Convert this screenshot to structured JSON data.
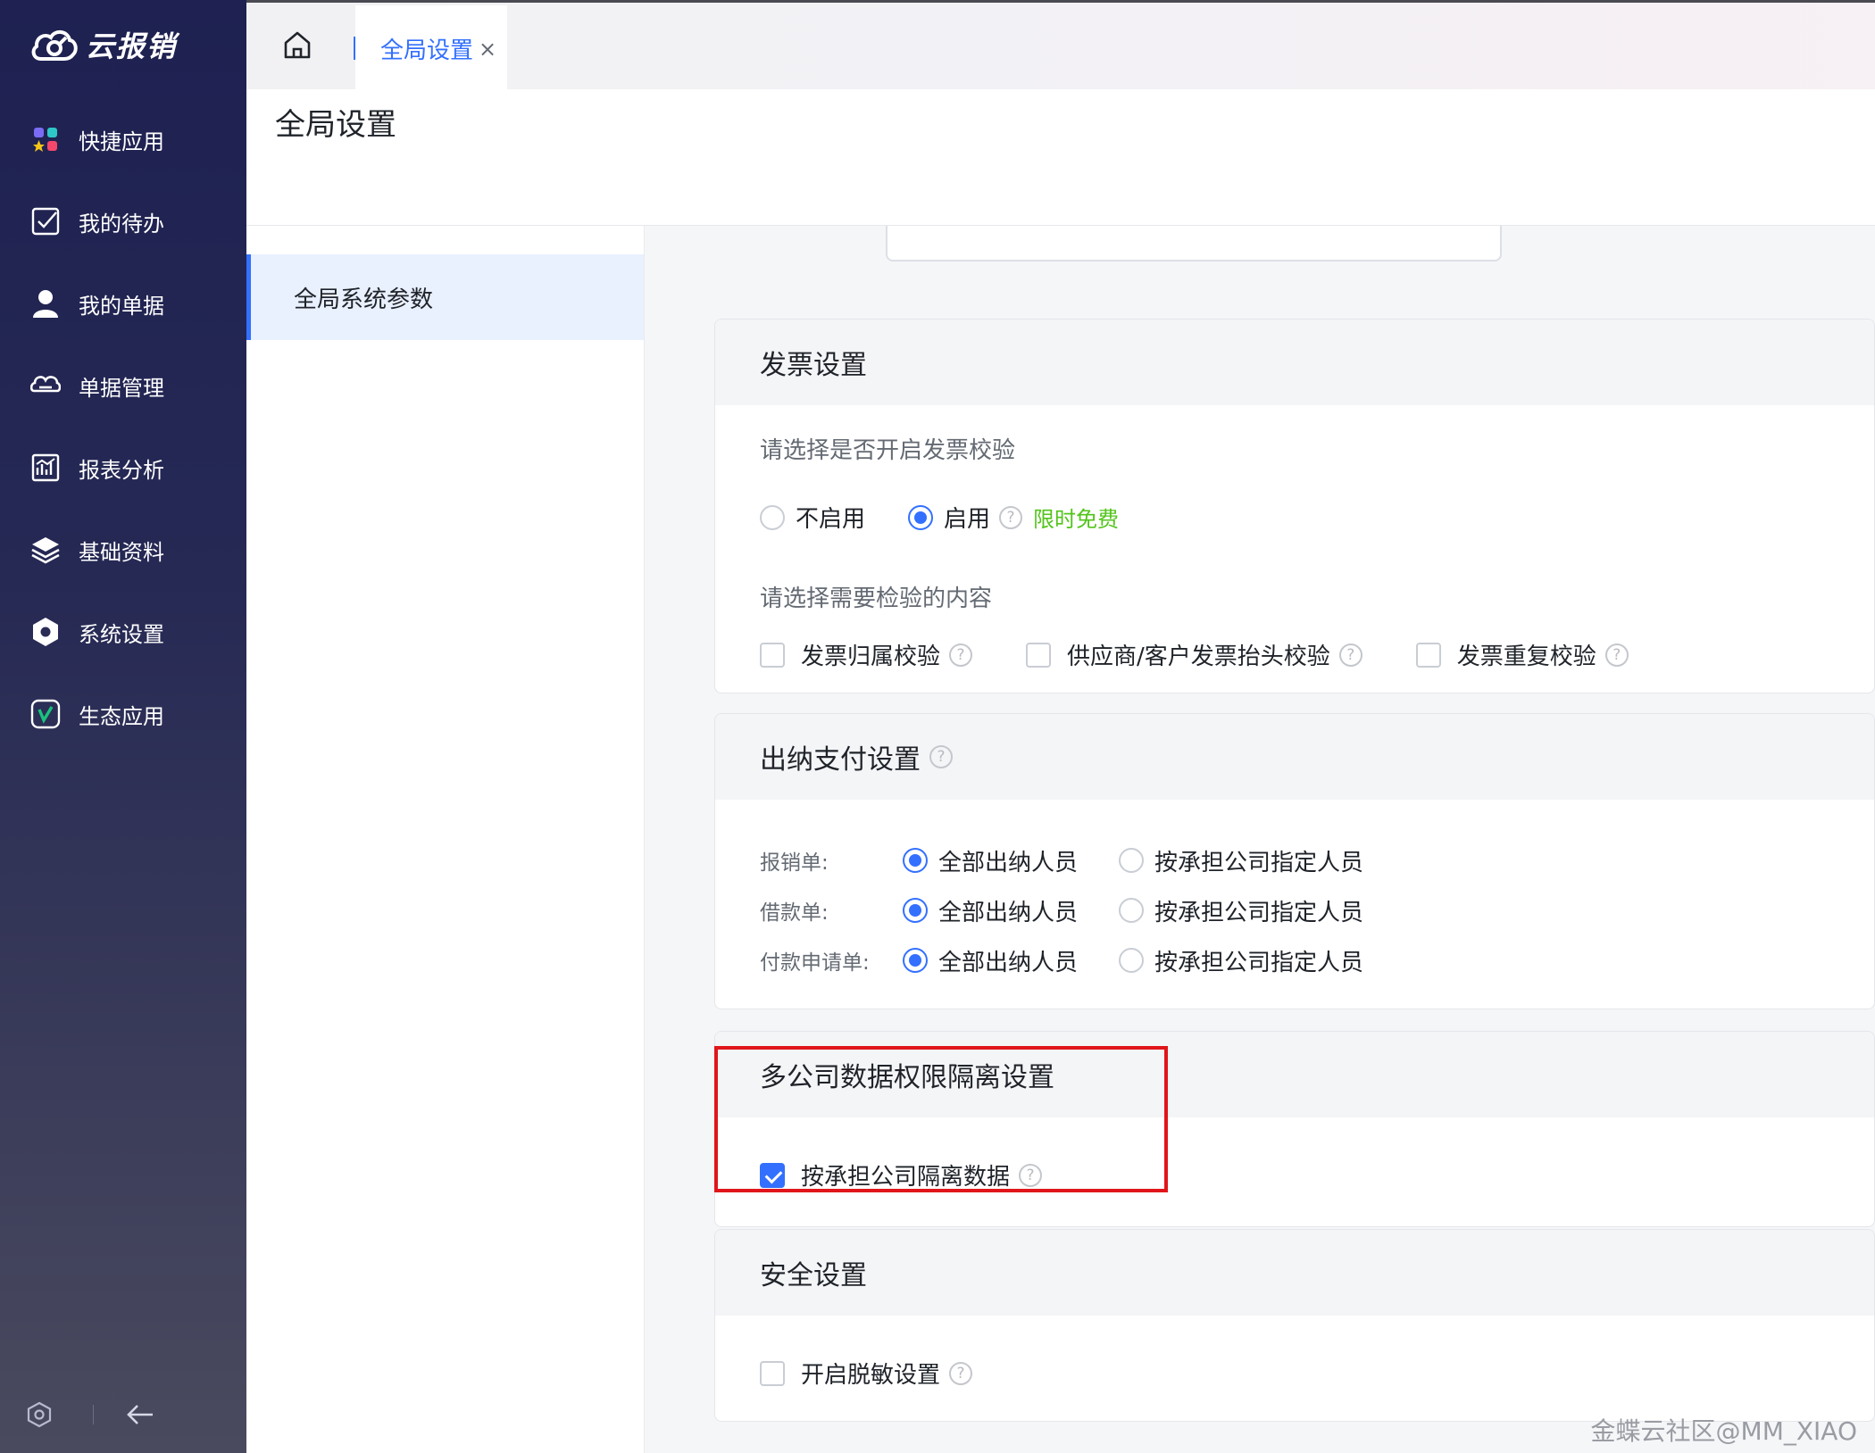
{
  "app": {
    "logo_text": "云报销"
  },
  "sidebar": {
    "items": [
      {
        "label": "快捷应用",
        "icon": "apps-grid-icon"
      },
      {
        "label": "我的待办",
        "icon": "todo-check-icon"
      },
      {
        "label": "我的单据",
        "icon": "user-icon"
      },
      {
        "label": "单据管理",
        "icon": "document-manage-icon"
      },
      {
        "label": "报表分析",
        "icon": "report-chart-icon"
      },
      {
        "label": "基础资料",
        "icon": "layers-icon"
      },
      {
        "label": "系统设置",
        "icon": "settings-hex-icon"
      },
      {
        "label": "生态应用",
        "icon": "ecosystem-app-icon"
      }
    ]
  },
  "tabs": {
    "active_label": "全局设置",
    "close": "×"
  },
  "page": {
    "title": "全局设置"
  },
  "leftmenu": {
    "active_label": "全局系统参数"
  },
  "invoice": {
    "title": "发票设置",
    "enable_prompt": "请选择是否开启发票校验",
    "opt_disable": "不启用",
    "opt_enable": "启用",
    "free_tag": "限时免费",
    "content_prompt": "请选择需要检验的内容",
    "check_ownership": "发票归属校验",
    "check_header": "供应商/客户发票抬头校验",
    "check_duplicate": "发票重复校验"
  },
  "cashier": {
    "title": "出纳支付设置",
    "rows": [
      {
        "label": "报销单:",
        "opt_all": "全部出纳人员",
        "opt_company": "按承担公司指定人员"
      },
      {
        "label": "借款单:",
        "opt_all": "全部出纳人员",
        "opt_company": "按承担公司指定人员"
      },
      {
        "label": "付款申请单:",
        "opt_all": "全部出纳人员",
        "opt_company": "按承担公司指定人员"
      }
    ]
  },
  "multicompany": {
    "title": "多公司数据权限隔离设置",
    "isolate_label": "按承担公司隔离数据"
  },
  "security": {
    "title": "安全设置",
    "desensitize_label": "开启脱敏设置"
  },
  "watermark": "金蝶云社区@MM_XIAO",
  "colors": {
    "accent": "#3370ff",
    "highlight": "#e0161b",
    "free_tag": "#52c41a"
  }
}
